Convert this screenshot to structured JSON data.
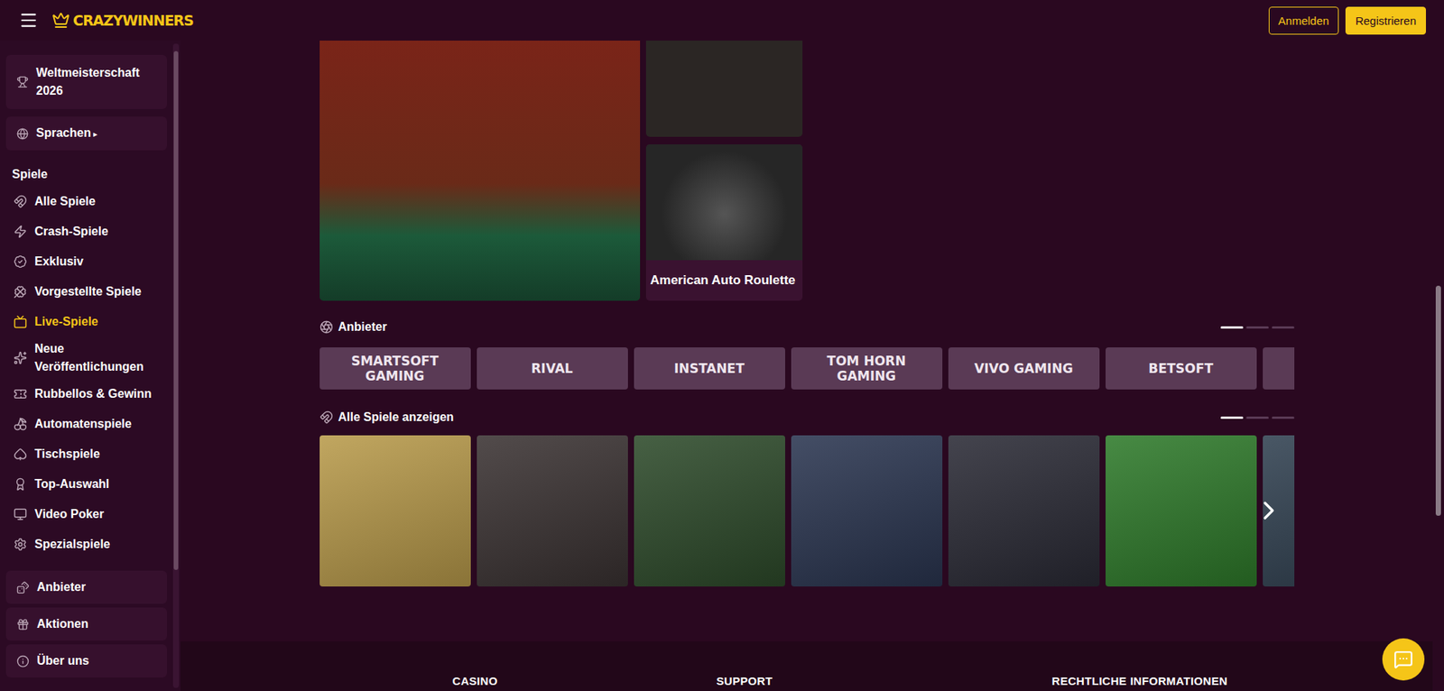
{
  "header": {
    "logo": "CRAZYWINNERS",
    "buttons": [
      {
        "label": "Anmelden",
        "kind": "outline"
      },
      {
        "label": "Registrieren",
        "kind": "filled"
      }
    ]
  },
  "sidebar": {
    "top": [
      {
        "label": "Weltmeisterschaft 2026",
        "arrow": ""
      },
      {
        "label": "Sprachen",
        "arrow": "▸"
      }
    ],
    "section": "Spiele",
    "items": [
      {
        "label": "Alle Spiele",
        "selected": false
      },
      {
        "label": "Crash-Spiele",
        "selected": false
      },
      {
        "label": "Exklusiv",
        "selected": false
      },
      {
        "label": "Vorgestellte Spiele",
        "selected": false
      },
      {
        "label": "Live-Spiele",
        "selected": true
      },
      {
        "label": "Neue Veröffentlichungen",
        "selected": false
      },
      {
        "label": "Rubbellos & Gewinn",
        "selected": false
      },
      {
        "label": "Automatenspiele",
        "selected": false
      },
      {
        "label": "Tischspiele",
        "selected": false
      },
      {
        "label": "Top-Auswahl",
        "selected": false
      },
      {
        "label": "Video Poker",
        "selected": false
      },
      {
        "label": "Spezialspiele",
        "selected": false
      }
    ],
    "bottom": [
      "Anbieter",
      "Aktionen",
      "Über uns"
    ]
  },
  "featured": [
    {
      "kind": "large",
      "caption": "",
      "color": "#7a2418"
    },
    {
      "kind": "small",
      "caption": "",
      "color": "#2b2624"
    },
    {
      "kind": "captioned",
      "caption": "American Auto Roulette",
      "color": "#262626"
    }
  ],
  "providers": {
    "title": "Anbieter",
    "pager": [
      true,
      false,
      false
    ],
    "items": [
      {
        "name": "SMARTSOFT GAMING"
      },
      {
        "name": "RIVAL"
      },
      {
        "name": "INSTANET"
      },
      {
        "name": "TOM HORN GAMING"
      },
      {
        "name": "VIVO GAMING"
      },
      {
        "name": "BETSOFT"
      },
      {
        "name": ""
      }
    ]
  },
  "games": {
    "title": "Alle Spiele anzeigen",
    "pager": [
      true,
      false,
      false
    ],
    "items": [
      {
        "color": "#b89a4a"
      },
      {
        "color": "#3a3232"
      },
      {
        "color": "#2d4a2a"
      },
      {
        "color": "#2a3550"
      },
      {
        "color": "#2a2a35"
      },
      {
        "color": "#2e7a2a"
      },
      {
        "color": "#304050"
      }
    ]
  },
  "footer": {
    "columns": [
      "CASINO",
      "SUPPORT",
      "RECHTLICHE INFORMATIONEN"
    ]
  }
}
